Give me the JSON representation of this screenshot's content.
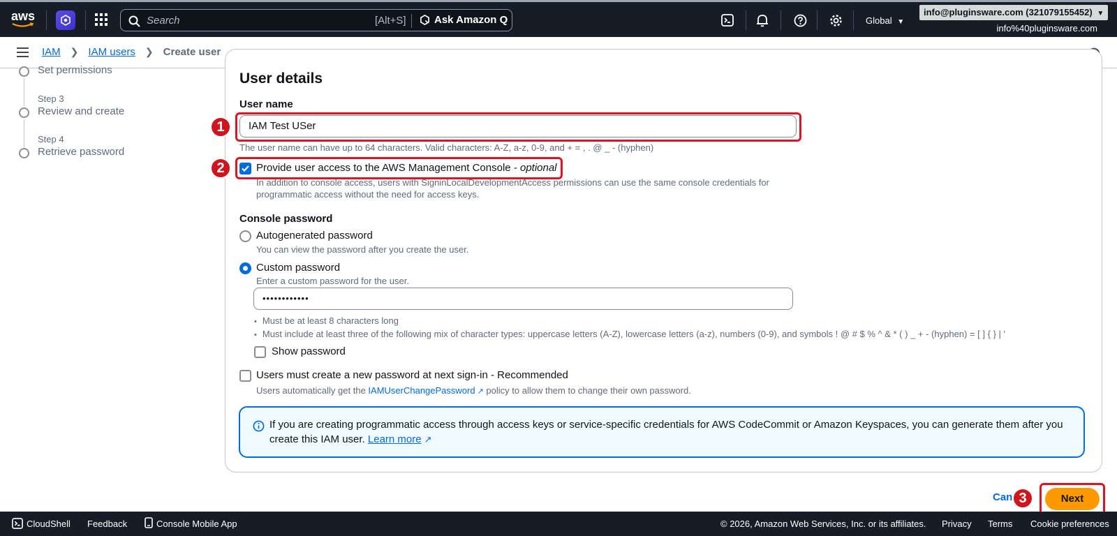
{
  "topnav": {
    "logo_text": "aws",
    "search_placeholder": "Search",
    "search_shortcut": "[Alt+S]",
    "ask_q_label": "Ask Amazon Q",
    "region_label": "Global",
    "account_chip": "info@pluginsware.com (321079155452)",
    "account_sub": "info%40pluginsware.com",
    "icons": [
      "aws-logo",
      "service-shortcut-icon",
      "apps-grid-icon",
      "search-icon",
      "cloudshell-icon",
      "notifications-icon",
      "help-icon",
      "settings-icon"
    ]
  },
  "breadcrumb": {
    "items": [
      "IAM",
      "IAM users"
    ],
    "current": "Create user"
  },
  "steps": [
    {
      "name": "Set permissions"
    },
    {
      "num": "Step 3",
      "name": "Review and create"
    },
    {
      "num": "Step 4",
      "name": "Retrieve password"
    }
  ],
  "form": {
    "title": "User details",
    "username_label": "User name",
    "username_value": "IAM Test USer",
    "username_hint": "The user name can have up to 64 characters. Valid characters: A-Z, a-z, 0-9, and + = , . @ _ - (hyphen)",
    "console_access_label": "Provide user access to the AWS Management Console",
    "console_access_optional": " - optional",
    "console_access_checked": true,
    "console_access_desc_1": "In addition to console access, users with SigninLocalDevelopmentAccess permissions can use the same console credentials for",
    "console_access_desc_2": "programmatic access without the need for access keys.",
    "password_label": "Console password",
    "auto_pw_label": "Autogenerated password",
    "auto_pw_desc": "You can view the password after you create the user.",
    "custom_pw_label": "Custom password",
    "custom_pw_desc": "Enter a custom password for the user.",
    "custom_pw_value": "••••••••••••",
    "rule_1": "Must be at least 8 characters long",
    "rule_2": "Must include at least three of the following mix of character types: uppercase letters (A-Z), lowercase letters (a-z), numbers (0-9), and symbols ! @ # $ % ^ & * ( ) _ + - (hyphen) = [ ] { } | '",
    "show_pw_label": "Show password",
    "reset_label": "Users must create a new password at next sign-in - Recommended",
    "reset_desc_pre": "Users automatically get the ",
    "reset_desc_link": "IAMUserChangePassword",
    "reset_desc_post": " policy to allow them to change their own password."
  },
  "alert": {
    "text_1": "If you are creating programmatic access through access keys or service-specific credentials for AWS CodeCommit or Amazon Keyspaces, you can generate them after you",
    "text_2": "create this IAM user. ",
    "link": "Learn more"
  },
  "actions": {
    "cancel": "Cancel",
    "next": "Next"
  },
  "annotations": [
    "1",
    "2",
    "3"
  ],
  "footer": {
    "cloudshell": "CloudShell",
    "feedback": "Feedback",
    "mobile_app": "Console Mobile App",
    "copyright": "© 2026, Amazon Web Services, Inc. or its affiliates.",
    "privacy": "Privacy",
    "terms": "Terms",
    "cookies": "Cookie preferences"
  },
  "colors": {
    "nav_bg": "#161d26",
    "link": "#006ce0",
    "primary_button": "#ff9900",
    "annotation_red": "#e3121f"
  }
}
